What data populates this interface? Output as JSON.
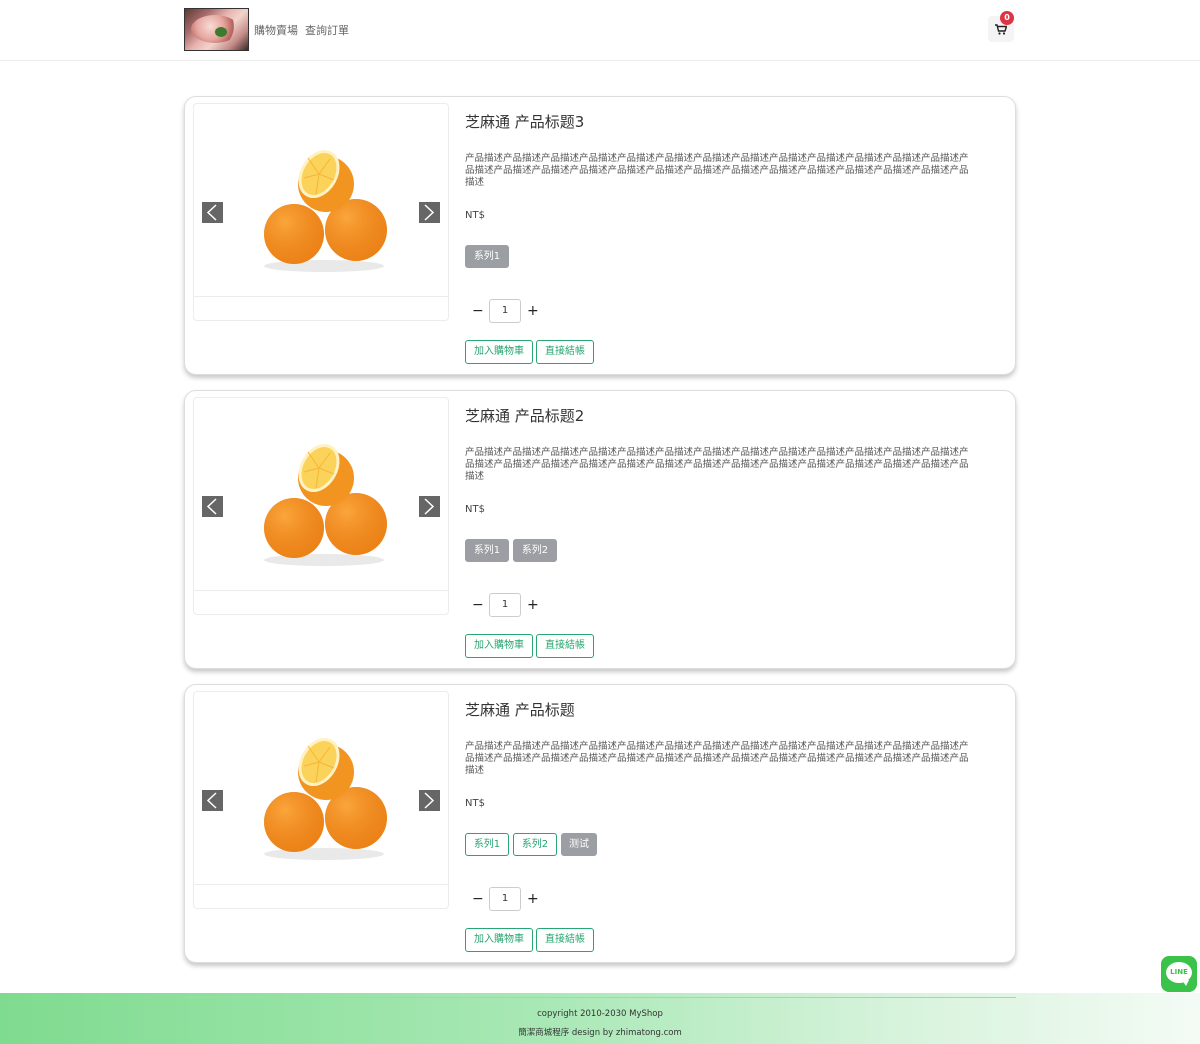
{
  "header": {
    "nav": [
      "購物賣場",
      "查詢訂單"
    ],
    "cart_count": "0"
  },
  "products": [
    {
      "title": "芝麻通 产品标题3",
      "description": "产品描述产品描述产品描述产品描述产品描述产品描述产品描述产品描述产品描述产品描述产品描述产品描述产品描述产品描述产品描述产品描述产品描述产品描述产品描述产品描述产品描述产品描述产品描述产品描述产品描述产品描述产品描述",
      "price": "NT$",
      "tags": [
        {
          "label": "系列1",
          "style": "filled"
        }
      ],
      "quantity": "1",
      "add_to_cart": "加入購物車",
      "checkout": "直接結帳"
    },
    {
      "title": "芝麻通 产品标题2",
      "description": "产品描述产品描述产品描述产品描述产品描述产品描述产品描述产品描述产品描述产品描述产品描述产品描述产品描述产品描述产品描述产品描述产品描述产品描述产品描述产品描述产品描述产品描述产品描述产品描述产品描述产品描述产品描述",
      "price": "NT$",
      "tags": [
        {
          "label": "系列1",
          "style": "filled"
        },
        {
          "label": "系列2",
          "style": "filled"
        }
      ],
      "quantity": "1",
      "add_to_cart": "加入購物車",
      "checkout": "直接結帳"
    },
    {
      "title": "芝麻通 产品标题",
      "description": "产品描述产品描述产品描述产品描述产品描述产品描述产品描述产品描述产品描述产品描述产品描述产品描述产品描述产品描述产品描述产品描述产品描述产品描述产品描述产品描述产品描述产品描述产品描述产品描述产品描述产品描述产品描述",
      "price": "NT$",
      "tags": [
        {
          "label": "系列1",
          "style": "outline"
        },
        {
          "label": "系列2",
          "style": "outline"
        },
        {
          "label": "测试",
          "style": "filled"
        }
      ],
      "quantity": "1",
      "add_to_cart": "加入購物車",
      "checkout": "直接結帳"
    }
  ],
  "qty_minus": "−",
  "qty_plus": "+",
  "footer": {
    "copyright": "copyright 2010-2030 MyShop",
    "credit": "簡潔商城程序 design by zhimatong.com"
  },
  "line_label": "LINE",
  "colors": {
    "accent_green": "#28a570",
    "tag_gray": "#9b9ea2",
    "badge_red": "#dc3545",
    "line_green": "#3ac24a"
  }
}
